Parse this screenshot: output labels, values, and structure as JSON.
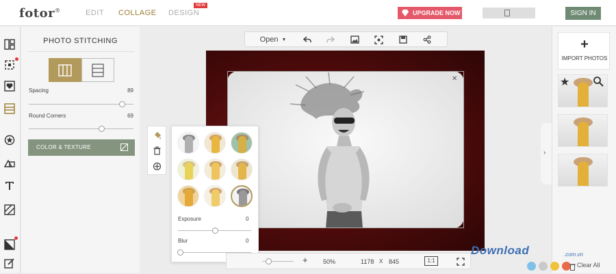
{
  "header": {
    "logo": "fotor",
    "logo_mark": "®",
    "nav": [
      "EDIT",
      "COLLAGE",
      "DESIGN"
    ],
    "new_badge": "NEW",
    "upgrade_label": "UPGRADE NOW",
    "signin_label": "SIGN IN"
  },
  "panel": {
    "title": "PHOTO STITCHING",
    "spacing_label": "Spacing",
    "spacing_value": "89",
    "round_label": "Round Corners",
    "round_value": "69",
    "color_texture_label": "COLOR & TEXTURE"
  },
  "toolbar": {
    "open_label": "Open"
  },
  "popup": {
    "exposure_label": "Exposure",
    "exposure_value": "0",
    "blur_label": "Blur",
    "blur_value": "0"
  },
  "bottombar": {
    "zoom_in": "+",
    "zoom_pct": "50%",
    "width": "1178",
    "x": "X",
    "height": "845",
    "ratio": "1:1"
  },
  "right": {
    "import_label": "IMPORT PHOTOS",
    "clear_all": "Clear All"
  },
  "watermark": {
    "text": "Download",
    "sub": ".com.vn"
  },
  "colors": {
    "accent": "#b29a5c",
    "upgrade": "#e4596a",
    "signin": "#6f8b74",
    "canvas": "#5a0d0d"
  }
}
